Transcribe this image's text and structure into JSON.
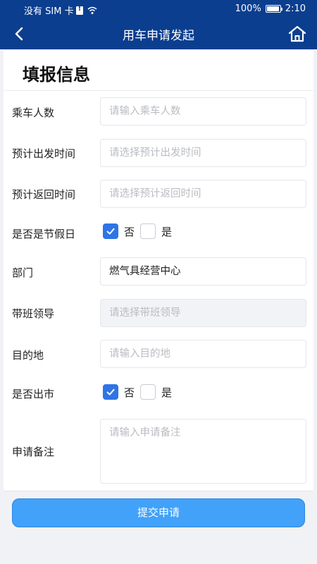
{
  "status_bar": {
    "carrier": "没有 SIM 卡",
    "battery": "100%",
    "time": "2:10"
  },
  "header": {
    "title": "用车申请发起",
    "back_icon": "chevron-left-icon",
    "home_icon": "home-icon"
  },
  "form": {
    "section_title": "填报信息",
    "passenger_count": {
      "label": "乘车人数",
      "placeholder": "请输入乘车人数"
    },
    "departure_time": {
      "label": "预计出发时间",
      "placeholder": "请选择预计出发时间"
    },
    "return_time": {
      "label": "预计返回时间",
      "placeholder": "请选择预计返回时间"
    },
    "holiday": {
      "label": "是否是节假日",
      "no_label": "否",
      "yes_label": "是",
      "selected": "否"
    },
    "department": {
      "label": "部门",
      "value": "燃气具经营中心"
    },
    "team_leader": {
      "label": "带班领导",
      "placeholder": "请选择带班领导"
    },
    "destination": {
      "label": "目的地",
      "placeholder": "请输入目的地"
    },
    "out_of_city": {
      "label": "是否出市",
      "no_label": "否",
      "yes_label": "是",
      "selected": "否"
    },
    "remarks": {
      "label": "申请备注",
      "placeholder": "请输入申请备注"
    }
  },
  "actions": {
    "submit_label": "提交申请"
  },
  "colors": {
    "header_bg": "#0b3e8f",
    "checkbox_checked": "#2f74e6",
    "submit_bg": "#42a1f8"
  }
}
